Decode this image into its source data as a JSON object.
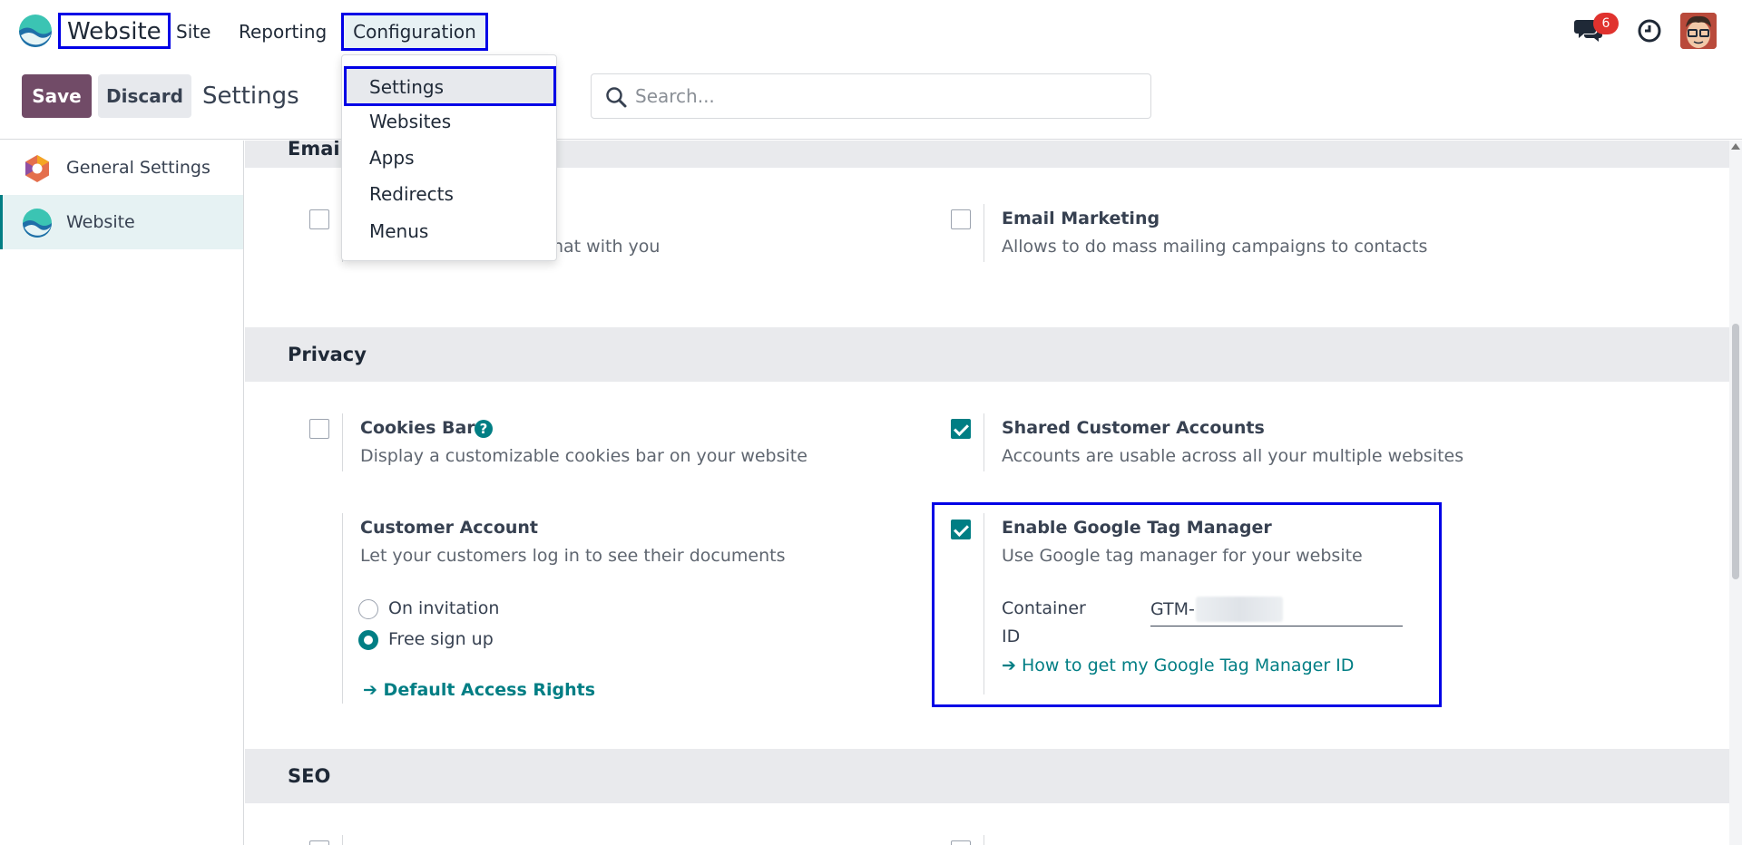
{
  "topnav": {
    "brand": "Website",
    "items": [
      "Site",
      "Reporting",
      "Configuration"
    ],
    "chat_badge": "6",
    "icons": [
      "chat-icon",
      "clock-icon",
      "user-avatar"
    ]
  },
  "dropdown": {
    "items": [
      "Settings",
      "Websites",
      "Apps",
      "Redirects",
      "Menus"
    ]
  },
  "control": {
    "save_label": "Save",
    "discard_label": "Discard",
    "title": "Settings",
    "search_placeholder": "Search..."
  },
  "sidebar": {
    "items": [
      {
        "label": "General Settings",
        "icon": "general-settings-icon"
      },
      {
        "label": "Website",
        "icon": "website-app-icon"
      }
    ]
  },
  "email_section": {
    "title": "Email",
    "left_desc_fragment": "hat with you",
    "right_title": "Email Marketing",
    "right_desc": "Allows to do mass mailing campaigns to contacts"
  },
  "privacy": {
    "title": "Privacy",
    "cookies_title": "Cookies Bar",
    "cookies_desc": "Display a customizable cookies bar on your website",
    "shared_title": "Shared Customer Accounts",
    "shared_desc": "Accounts are usable across all your multiple websites",
    "customer_title": "Customer Account",
    "customer_desc": "Let your customers log in to see their documents",
    "radio_options": [
      "On invitation",
      "Free sign up"
    ],
    "radio_selected": "Free sign up",
    "default_rights_link": "Default Access Rights",
    "gtm_title": "Enable Google Tag Manager",
    "gtm_desc": "Use Google tag manager for your website",
    "container_label_1": "Container",
    "container_label_2": "ID",
    "container_value": "GTM-",
    "gtm_link": "How to get my Google Tag Manager ID"
  },
  "seo": {
    "title": "SEO"
  },
  "colors": {
    "primary": "#714b67",
    "accent": "#017e84",
    "highlight": "#0000e6"
  }
}
